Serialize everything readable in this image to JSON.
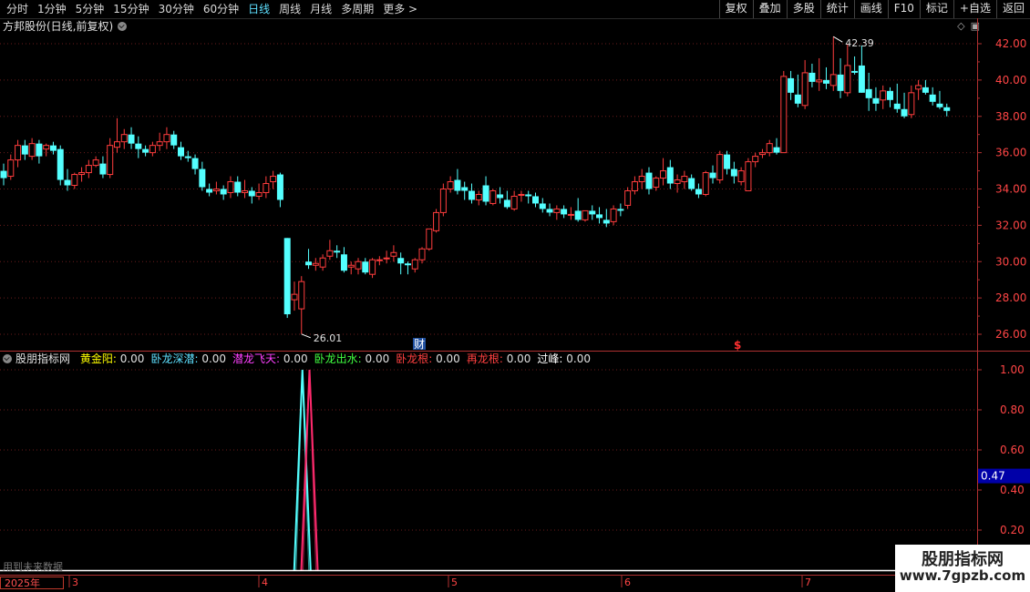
{
  "toolbar": {
    "periods": [
      "分时",
      "1分钟",
      "5分钟",
      "15分钟",
      "30分钟",
      "60分钟",
      "日线",
      "周线",
      "月线",
      "多周期",
      "更多 >"
    ],
    "active_period": "日线",
    "buttons": [
      "复权",
      "叠加",
      "多股",
      "统计",
      "画线",
      "F10",
      "标记",
      "+自选",
      "返回"
    ]
  },
  "stock": {
    "title": "方邦股份(日线,前复权)"
  },
  "price_axis": {
    "labels": [
      "42.00",
      "40.00",
      "38.00",
      "36.00",
      "34.00",
      "32.00",
      "30.00",
      "28.00",
      "26.00"
    ]
  },
  "annotations": {
    "high": "42.39",
    "low": "26.01",
    "cai_marker": "财",
    "s_marker": "$"
  },
  "indicator": {
    "name": "股朋指标网",
    "items": [
      {
        "label": "黄金阳",
        "value": "0.00",
        "color": "#ffff00"
      },
      {
        "label": "卧龙深潜",
        "value": "0.00",
        "color": "#5ee0ff"
      },
      {
        "label": "潜龙飞天",
        "value": "0.00",
        "color": "#ff40ff"
      },
      {
        "label": "卧龙出水",
        "value": "0.00",
        "color": "#40ff40"
      },
      {
        "label": "卧龙根",
        "value": "0.00",
        "color": "#ff4040"
      },
      {
        "label": "再龙根",
        "value": "0.00",
        "color": "#ff4040"
      },
      {
        "label": "过峰",
        "value": "0.00",
        "color": "#ffffff"
      }
    ],
    "axis": [
      "1.00",
      "0.80",
      "0.60",
      "0.40",
      "0.20"
    ],
    "cursor_value": "0.47"
  },
  "time_axis": {
    "year": "2025年",
    "months": [
      "3",
      "4",
      "5",
      "6",
      "7"
    ]
  },
  "footer": {
    "future_note": "用到未来数据"
  },
  "watermark": {
    "line1": "股朋指标网",
    "line2": "www.7gpzb.com"
  },
  "colors": {
    "up": "#ff3d3d",
    "down": "#54ffff",
    "grid": "#5a1a1a",
    "axis": "#b03030"
  },
  "chart_data": {
    "type": "candlestick",
    "ylim": [
      25.5,
      43.0
    ],
    "candles": [
      [
        35.0,
        35.4,
        34.2,
        34.6
      ],
      [
        34.7,
        35.9,
        34.5,
        35.6
      ],
      [
        35.6,
        36.7,
        35.2,
        36.4
      ],
      [
        36.4,
        36.7,
        35.6,
        35.9
      ],
      [
        35.8,
        36.8,
        35.6,
        36.5
      ],
      [
        36.5,
        36.7,
        35.4,
        35.8
      ],
      [
        36.2,
        36.5,
        35.8,
        36.4
      ],
      [
        36.4,
        36.6,
        35.9,
        36.1
      ],
      [
        36.2,
        36.4,
        34.2,
        34.5
      ],
      [
        34.5,
        35.1,
        33.9,
        34.2
      ],
      [
        34.2,
        34.9,
        34.0,
        34.8
      ],
      [
        34.8,
        35.2,
        34.4,
        34.9
      ],
      [
        34.9,
        35.6,
        34.6,
        35.3
      ],
      [
        35.3,
        35.8,
        35.2,
        35.6
      ],
      [
        35.4,
        35.8,
        34.6,
        34.8
      ],
      [
        34.8,
        36.8,
        34.6,
        36.4
      ],
      [
        36.3,
        37.9,
        36.0,
        36.6
      ],
      [
        36.6,
        37.3,
        36.2,
        37.0
      ],
      [
        37.0,
        37.4,
        36.2,
        36.5
      ],
      [
        36.5,
        36.9,
        35.7,
        36.2
      ],
      [
        36.2,
        36.4,
        35.8,
        36.0
      ],
      [
        36.0,
        36.6,
        35.8,
        36.4
      ],
      [
        36.4,
        37.1,
        36.1,
        36.6
      ],
      [
        36.6,
        37.4,
        36.2,
        37.0
      ],
      [
        37.0,
        37.2,
        36.2,
        36.4
      ],
      [
        36.3,
        36.6,
        35.6,
        35.8
      ],
      [
        35.8,
        36.1,
        35.5,
        35.7
      ],
      [
        35.7,
        35.9,
        34.8,
        35.1
      ],
      [
        35.1,
        35.5,
        33.9,
        34.1
      ],
      [
        34.0,
        34.3,
        33.6,
        33.8
      ],
      [
        33.9,
        34.4,
        33.7,
        34.0
      ],
      [
        34.0,
        34.2,
        33.4,
        33.7
      ],
      [
        33.8,
        34.7,
        33.5,
        34.4
      ],
      [
        34.4,
        34.7,
        33.6,
        33.8
      ],
      [
        33.8,
        34.5,
        33.5,
        33.9
      ],
      [
        33.9,
        34.1,
        33.2,
        33.6
      ],
      [
        33.6,
        34.3,
        33.4,
        33.8
      ],
      [
        33.8,
        34.7,
        33.5,
        34.3
      ],
      [
        34.4,
        35.0,
        34.0,
        34.7
      ],
      [
        34.8,
        34.9,
        33.0,
        33.4
      ],
      [
        31.3,
        31.3,
        26.9,
        27.1
      ],
      [
        27.9,
        28.9,
        27.3,
        28.2
      ],
      [
        27.4,
        29.2,
        26.01,
        28.9
      ],
      [
        30.0,
        30.7,
        29.6,
        29.8
      ],
      [
        29.8,
        30.2,
        29.5,
        29.9
      ],
      [
        29.7,
        30.4,
        29.5,
        30.2
      ],
      [
        30.3,
        31.2,
        30.1,
        30.6
      ],
      [
        30.6,
        30.9,
        30.2,
        30.5
      ],
      [
        30.4,
        30.8,
        29.4,
        29.5
      ],
      [
        29.7,
        30.0,
        29.3,
        29.8
      ],
      [
        29.6,
        30.2,
        29.3,
        30.0
      ],
      [
        30.0,
        30.2,
        29.3,
        29.4
      ],
      [
        29.3,
        30.2,
        29.1,
        30.1
      ],
      [
        30.1,
        30.3,
        29.8,
        30.1
      ],
      [
        30.2,
        30.6,
        29.9,
        30.2
      ],
      [
        30.3,
        30.9,
        30.0,
        30.5
      ],
      [
        30.2,
        30.5,
        29.3,
        29.9
      ],
      [
        29.9,
        30.0,
        29.3,
        29.8
      ],
      [
        29.6,
        30.2,
        29.4,
        30.1
      ],
      [
        30.1,
        30.8,
        29.9,
        30.7
      ],
      [
        30.7,
        31.8,
        30.6,
        31.8
      ],
      [
        31.7,
        32.9,
        31.6,
        32.7
      ],
      [
        32.7,
        34.3,
        32.5,
        34.0
      ],
      [
        34.0,
        34.7,
        33.8,
        34.4
      ],
      [
        34.5,
        35.1,
        33.7,
        33.9
      ],
      [
        34.1,
        34.4,
        33.4,
        33.9
      ],
      [
        33.9,
        34.3,
        33.2,
        33.4
      ],
      [
        33.4,
        33.9,
        33.1,
        33.7
      ],
      [
        34.2,
        34.7,
        33.1,
        33.3
      ],
      [
        33.2,
        34.0,
        33.1,
        33.9
      ],
      [
        33.7,
        34.1,
        33.2,
        33.5
      ],
      [
        33.4,
        33.9,
        32.9,
        33.0
      ],
      [
        32.9,
        33.9,
        32.8,
        33.6
      ],
      [
        33.7,
        33.9,
        33.3,
        33.7
      ],
      [
        33.7,
        33.9,
        33.2,
        33.6
      ],
      [
        33.6,
        33.8,
        33.0,
        33.2
      ],
      [
        33.2,
        33.5,
        32.7,
        32.9
      ],
      [
        32.9,
        33.2,
        32.5,
        32.7
      ],
      [
        32.7,
        33.1,
        32.3,
        32.9
      ],
      [
        32.9,
        33.1,
        32.4,
        32.6
      ],
      [
        32.6,
        33.0,
        32.3,
        32.6
      ],
      [
        32.8,
        33.5,
        32.2,
        32.3
      ],
      [
        32.3,
        32.8,
        32.2,
        32.8
      ],
      [
        32.8,
        33.1,
        32.3,
        32.6
      ],
      [
        32.6,
        33.0,
        32.1,
        32.4
      ],
      [
        32.3,
        32.9,
        31.9,
        32.1
      ],
      [
        32.2,
        33.1,
        32.0,
        32.9
      ],
      [
        32.9,
        33.2,
        32.5,
        32.8
      ],
      [
        33.1,
        34.1,
        32.9,
        33.9
      ],
      [
        33.9,
        34.7,
        33.7,
        34.4
      ],
      [
        34.4,
        35.1,
        34.0,
        34.7
      ],
      [
        34.9,
        35.2,
        33.7,
        34.0
      ],
      [
        34.1,
        34.7,
        33.9,
        34.6
      ],
      [
        34.6,
        35.7,
        34.2,
        35.0
      ],
      [
        35.2,
        35.6,
        34.0,
        34.3
      ],
      [
        34.3,
        34.8,
        33.8,
        34.5
      ],
      [
        34.4,
        35.0,
        34.0,
        34.7
      ],
      [
        34.6,
        34.8,
        33.9,
        34.0
      ],
      [
        34.0,
        34.3,
        33.5,
        33.7
      ],
      [
        33.7,
        35.0,
        33.6,
        34.9
      ],
      [
        34.9,
        35.3,
        34.3,
        34.6
      ],
      [
        34.5,
        36.1,
        34.3,
        35.9
      ],
      [
        35.9,
        36.1,
        34.8,
        35.1
      ],
      [
        35.1,
        35.5,
        34.3,
        34.7
      ],
      [
        34.4,
        35.2,
        34.2,
        35.0
      ],
      [
        33.9,
        35.7,
        33.9,
        35.5
      ],
      [
        35.5,
        36.0,
        35.2,
        35.8
      ],
      [
        35.9,
        36.2,
        35.7,
        36.0
      ],
      [
        36.0,
        36.7,
        35.8,
        36.5
      ],
      [
        36.3,
        36.8,
        35.9,
        36.0
      ],
      [
        36.0,
        40.5,
        36.0,
        40.2
      ],
      [
        40.1,
        40.5,
        38.9,
        39.3
      ],
      [
        39.2,
        40.3,
        38.5,
        38.7
      ],
      [
        38.6,
        41.1,
        38.4,
        40.4
      ],
      [
        40.4,
        40.9,
        39.6,
        39.9
      ],
      [
        39.9,
        41.2,
        39.4,
        40.0
      ],
      [
        40.0,
        40.7,
        39.5,
        39.8
      ],
      [
        39.7,
        42.39,
        39.4,
        40.3
      ],
      [
        40.3,
        41.2,
        39.0,
        39.4
      ],
      [
        39.3,
        42.0,
        39.1,
        40.8
      ],
      [
        40.5,
        41.3,
        40.3,
        40.4
      ],
      [
        40.8,
        41.9,
        39.3,
        39.3
      ],
      [
        39.5,
        40.4,
        38.3,
        39.0
      ],
      [
        39.0,
        39.6,
        38.3,
        38.7
      ],
      [
        38.9,
        39.7,
        38.4,
        39.4
      ],
      [
        39.4,
        39.6,
        38.5,
        38.9
      ],
      [
        38.7,
        39.8,
        38.2,
        38.4
      ],
      [
        38.4,
        39.3,
        37.9,
        38.0
      ],
      [
        38.1,
        39.7,
        37.9,
        39.3
      ],
      [
        39.5,
        40.0,
        38.9,
        39.7
      ],
      [
        39.6,
        40.0,
        39.2,
        39.3
      ],
      [
        39.2,
        39.6,
        38.6,
        38.8
      ],
      [
        38.7,
        39.4,
        38.4,
        38.5
      ],
      [
        38.5,
        38.7,
        38.0,
        38.3
      ]
    ],
    "up_color": "#ff3d3d",
    "down_color": "#54ffff"
  }
}
